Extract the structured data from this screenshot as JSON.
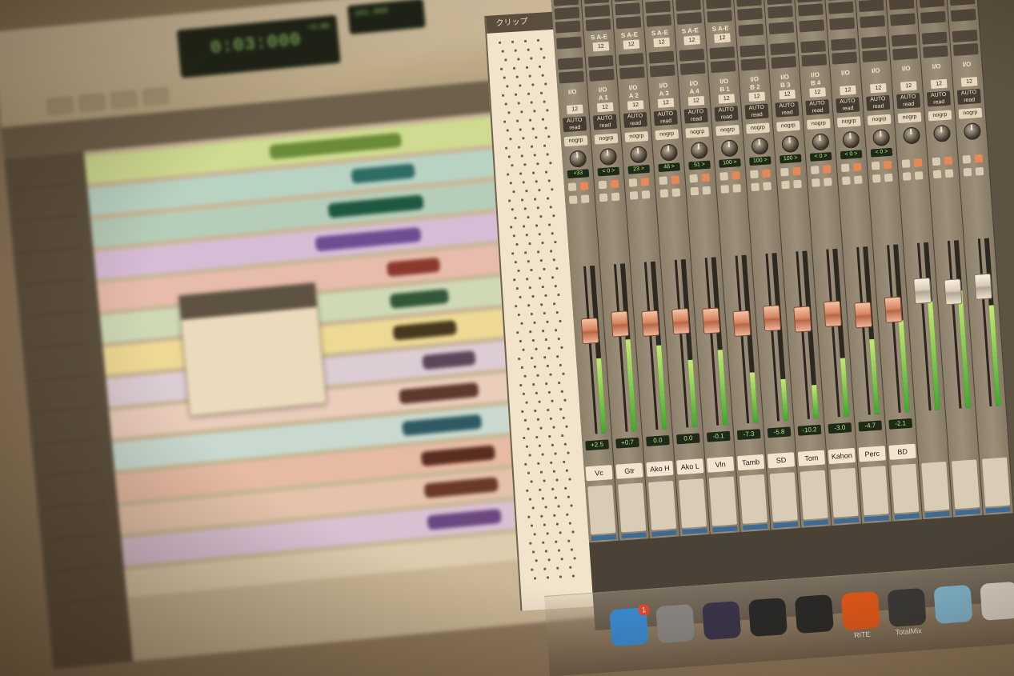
{
  "edit_window": {
    "counter_main": "0:03:000",
    "counter_sub": "+3:00",
    "counter2_text": "161.000",
    "tracks": [
      {
        "color": "#cfe29a",
        "wave": "#6a8f3a",
        "wave_start": 0.35,
        "wave_end": 0.6
      },
      {
        "color": "#b9d9d0",
        "wave": "#2f6f6a",
        "wave_start": 0.5,
        "wave_end": 0.62
      },
      {
        "color": "#b6d4c5",
        "wave": "#1f5a44",
        "wave_start": 0.45,
        "wave_end": 0.63
      },
      {
        "color": "#d6c3e4",
        "wave": "#6e4f9a",
        "wave_start": 0.42,
        "wave_end": 0.62
      },
      {
        "color": "#e8c2b7",
        "wave": "#8a3a30",
        "wave_start": 0.55,
        "wave_end": 0.65
      },
      {
        "color": "#cfe0c2",
        "wave": "#325a3c",
        "wave_start": 0.55,
        "wave_end": 0.66
      },
      {
        "color": "#eedf9d",
        "wave": "#463a1e",
        "wave_start": 0.55,
        "wave_end": 0.67
      },
      {
        "color": "#dcd2e2",
        "wave": "#5a4a5e",
        "wave_start": 0.6,
        "wave_end": 0.7
      },
      {
        "color": "#ebd3c8",
        "wave": "#5e3a30",
        "wave_start": 0.55,
        "wave_end": 0.7
      },
      {
        "color": "#c9e0dc",
        "wave": "#2f5c6a",
        "wave_start": 0.55,
        "wave_end": 0.7
      },
      {
        "color": "#e7c1ad",
        "wave": "#5a2e22",
        "wave_start": 0.58,
        "wave_end": 0.72
      },
      {
        "color": "#e5c9b5",
        "wave": "#6a3a2a",
        "wave_start": 0.58,
        "wave_end": 0.72
      },
      {
        "color": "#d9c7e1",
        "wave": "#6a4a8a",
        "wave_start": 0.58,
        "wave_end": 0.72
      },
      {
        "color": "#ddd2b8",
        "wave": "#8a7a5a",
        "wave_start": 0.0,
        "wave_end": 0.0
      }
    ]
  },
  "clip_list": {
    "title": "クリップ"
  },
  "mixer": {
    "channels": [
      {
        "name": "Vc",
        "volume": "+2.5",
        "pan": "+33",
        "io_out": "",
        "send": "",
        "fader": 0.62,
        "meter": 0.45,
        "cap": "orange"
      },
      {
        "name": "Gtr",
        "volume": "+0.7",
        "pan": "< 0 >",
        "io_out": "A 1",
        "send": "S A-E",
        "fader": 0.65,
        "meter": 0.55,
        "cap": "orange"
      },
      {
        "name": "Ako H",
        "volume": "0.0",
        "pan": "23 >",
        "io_out": "A 2",
        "send": "S A-E",
        "fader": 0.64,
        "meter": 0.5,
        "cap": "orange"
      },
      {
        "name": "Ako L",
        "volume": "0.0",
        "pan": "48 >",
        "io_out": "A 3",
        "send": "S A-E",
        "fader": 0.64,
        "meter": 0.4,
        "cap": "orange"
      },
      {
        "name": "Vln",
        "volume": "-0.1",
        "pan": "51 >",
        "io_out": "A 4",
        "send": "S A-E",
        "fader": 0.63,
        "meter": 0.45,
        "cap": "orange"
      },
      {
        "name": "Tamb",
        "volume": "-7.3",
        "pan": "100 >",
        "io_out": "B 1",
        "send": "S A-E",
        "fader": 0.6,
        "meter": 0.3,
        "cap": "orange"
      },
      {
        "name": "SD",
        "volume": "-5.8",
        "pan": "100 >",
        "io_out": "B 2",
        "send": "",
        "fader": 0.62,
        "meter": 0.25,
        "cap": "orange"
      },
      {
        "name": "Tom",
        "volume": "-10.2",
        "pan": "100 >",
        "io_out": "B 3",
        "send": "",
        "fader": 0.6,
        "meter": 0.2,
        "cap": "orange"
      },
      {
        "name": "Kahon",
        "volume": "-3.0",
        "pan": "< 0 >",
        "io_out": "B 4",
        "send": "",
        "fader": 0.62,
        "meter": 0.35,
        "cap": "orange"
      },
      {
        "name": "Perc",
        "volume": "-4.7",
        "pan": "< 0 >",
        "io_out": "",
        "send": "",
        "fader": 0.6,
        "meter": 0.45,
        "cap": "orange"
      },
      {
        "name": "BD",
        "volume": "-2.1",
        "pan": "< 0 >",
        "io_out": "",
        "send": "",
        "fader": 0.62,
        "meter": 0.55,
        "cap": "orange"
      },
      {
        "name": "",
        "volume": "",
        "pan": "",
        "io_out": "",
        "send": "",
        "fader": 0.72,
        "meter": 0.65,
        "cap": "grey"
      },
      {
        "name": "",
        "volume": "",
        "pan": "",
        "io_out": "",
        "send": "",
        "fader": 0.7,
        "meter": 0.7,
        "cap": "grey"
      },
      {
        "name": "",
        "volume": "",
        "pan": "",
        "io_out": "",
        "send": "",
        "fader": 0.72,
        "meter": 0.6,
        "cap": "grey"
      }
    ],
    "labels": {
      "io": "I/O",
      "auto": "AUTO",
      "read": "read",
      "group": "nogrp",
      "send_value": "12"
    }
  },
  "dock": {
    "items": [
      {
        "name": "app-store",
        "color": "#3b8fe0",
        "label": ""
      },
      {
        "name": "system-preferences",
        "color": "#8a8a8a",
        "label": ""
      },
      {
        "name": "pro-tools",
        "color": "#3a3550",
        "label": ""
      },
      {
        "name": "ua-console",
        "color": "#2a2a2a",
        "label": ""
      },
      {
        "name": "ua-meter",
        "color": "#2a2a2a",
        "label": ""
      },
      {
        "name": "fire",
        "color": "#e05a1a",
        "label": "RITE"
      },
      {
        "name": "totalmix",
        "color": "#3a3a3a",
        "label": "TotalMix"
      },
      {
        "name": "finder-folder",
        "color": "#7fb9d9",
        "label": ""
      },
      {
        "name": "trash",
        "color": "#d9d6cf",
        "label": ""
      }
    ],
    "badge": "1"
  },
  "colors": {
    "meter": "#3fae2f",
    "counter_text": "#9fe07a",
    "fader_cap": "#d98a68"
  }
}
